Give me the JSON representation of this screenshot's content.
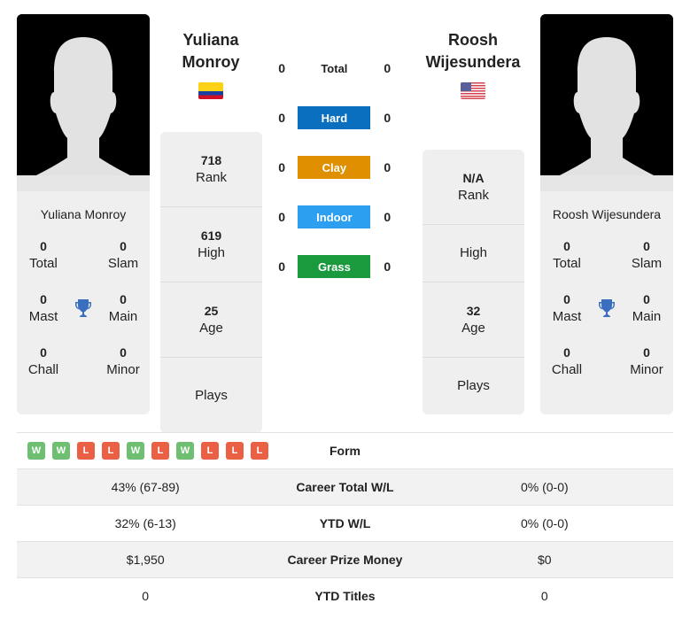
{
  "player1": {
    "name_line1": "Yuliana",
    "name_line2": "Monroy",
    "full_name": "Yuliana Monroy",
    "flag": "colombia-flag",
    "titles": {
      "total": "0",
      "slam": "0",
      "mast": "0",
      "main": "0",
      "chall": "0",
      "minor": "0"
    },
    "stats": {
      "rank": "718",
      "high": "619",
      "age": "25",
      "plays": ""
    }
  },
  "player2": {
    "name_line1": "Roosh",
    "name_line2": "Wijesundera",
    "full_name": "Roosh Wijesundera",
    "flag": "usa-flag",
    "titles": {
      "total": "0",
      "slam": "0",
      "mast": "0",
      "main": "0",
      "chall": "0",
      "minor": "0"
    },
    "stats": {
      "rank": "N/A",
      "high": "",
      "age": "32",
      "plays": ""
    }
  },
  "labels": {
    "total": "Total",
    "slam": "Slam",
    "mast": "Mast",
    "main": "Main",
    "chall": "Chall",
    "minor": "Minor",
    "rank": "Rank",
    "high": "High",
    "age": "Age",
    "plays": "Plays"
  },
  "surfaces": [
    {
      "label": "Total",
      "p1": "0",
      "p2": "0",
      "color": ""
    },
    {
      "label": "Hard",
      "p1": "0",
      "p2": "0",
      "color": "#0b6fc0"
    },
    {
      "label": "Clay",
      "p1": "0",
      "p2": "0",
      "color": "#e08f00"
    },
    {
      "label": "Indoor",
      "p1": "0",
      "p2": "0",
      "color": "#2c9ff0"
    },
    {
      "label": "Grass",
      "p1": "0",
      "p2": "0",
      "color": "#1a9a3c"
    }
  ],
  "form": {
    "label": "Form",
    "results": [
      "W",
      "W",
      "L",
      "L",
      "W",
      "L",
      "W",
      "L",
      "L",
      "L"
    ],
    "win_color": "#6fbf73",
    "loss_color": "#ea6045"
  },
  "comparison": [
    {
      "label": "Career Total W/L",
      "p1": "43% (67-89)",
      "p2": "0% (0-0)"
    },
    {
      "label": "YTD W/L",
      "p1": "32% (6-13)",
      "p2": "0% (0-0)"
    },
    {
      "label": "Career Prize Money",
      "p1": "$1,950",
      "p2": "$0"
    },
    {
      "label": "YTD Titles",
      "p1": "0",
      "p2": "0"
    }
  ]
}
